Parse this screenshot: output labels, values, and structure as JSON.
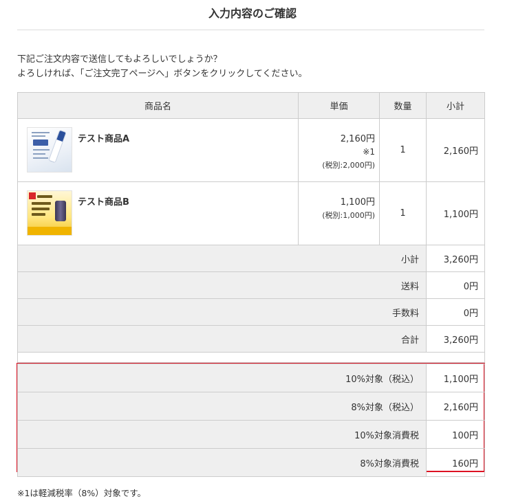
{
  "page": {
    "title": "入力内容のご確認",
    "intro_line1": "下記ご注文内容で送信してもよろしいでしょうか？",
    "intro_line2": "よろしければ、「ご注文完了ページへ」ボタンをクリックしてください。"
  },
  "table": {
    "headers": [
      "商品名",
      "単価",
      "数量",
      "小計"
    ],
    "items": [
      {
        "name": "テスト商品A",
        "price": "2,160円",
        "note": "※1",
        "tax_excluded": "(税別:2,000円)",
        "quantity": "1",
        "subtotal": "2,160円"
      },
      {
        "name": "テスト商品B",
        "price": "1,100円",
        "note": "",
        "tax_excluded": "(税別:1,000円)",
        "quantity": "1",
        "subtotal": "1,100円"
      }
    ],
    "summary": [
      {
        "label": "小計",
        "value": "3,260円"
      },
      {
        "label": "送料",
        "value": "0円"
      },
      {
        "label": "手数料",
        "value": "0円"
      },
      {
        "label": "合計",
        "value": "3,260円"
      }
    ]
  },
  "tax": {
    "rows": [
      {
        "label": "10%対象（税込）",
        "value": "1,100円"
      },
      {
        "label": "8%対象（税込）",
        "value": "2,160円"
      },
      {
        "label": "10%対象消費税",
        "value": "100円"
      },
      {
        "label": "8%対象消費税",
        "value": "160円"
      }
    ],
    "highlight_color": "#dd1122"
  },
  "footnote": "※1は軽減税率（8%）対象です。"
}
